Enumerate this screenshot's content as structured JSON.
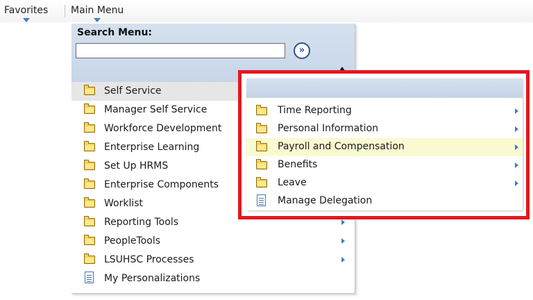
{
  "topbar": {
    "favorites_label": "Favorites",
    "main_menu_label": "Main Menu"
  },
  "search": {
    "label": "Search Menu:",
    "value": "",
    "placeholder": "",
    "go_symbol": "»"
  },
  "main_menu": {
    "items": [
      {
        "label": "Self Service",
        "icon": "folder-icon",
        "has_submenu": true,
        "active": true
      },
      {
        "label": "Manager Self Service",
        "icon": "folder-icon",
        "has_submenu": true
      },
      {
        "label": "Workforce Development",
        "icon": "folder-icon",
        "has_submenu": true
      },
      {
        "label": "Enterprise Learning",
        "icon": "folder-icon",
        "has_submenu": true
      },
      {
        "label": "Set Up HRMS",
        "icon": "folder-icon",
        "has_submenu": true
      },
      {
        "label": "Enterprise Components",
        "icon": "folder-icon",
        "has_submenu": true
      },
      {
        "label": "Worklist",
        "icon": "folder-icon",
        "has_submenu": true
      },
      {
        "label": "Reporting Tools",
        "icon": "folder-icon",
        "has_submenu": true
      },
      {
        "label": "PeopleTools",
        "icon": "folder-icon",
        "has_submenu": true
      },
      {
        "label": "LSUHSC Processes",
        "icon": "folder-icon",
        "has_submenu": true
      },
      {
        "label": "My Personalizations",
        "icon": "document-icon",
        "has_submenu": false
      }
    ]
  },
  "submenu": {
    "items": [
      {
        "label": "Time Reporting",
        "icon": "folder-icon",
        "has_submenu": true
      },
      {
        "label": "Personal Information",
        "icon": "folder-icon",
        "has_submenu": true
      },
      {
        "label": "Payroll and Compensation",
        "icon": "folder-icon",
        "has_submenu": true,
        "highlighted": true
      },
      {
        "label": "Benefits",
        "icon": "folder-icon",
        "has_submenu": true
      },
      {
        "label": "Leave",
        "icon": "folder-icon",
        "has_submenu": true
      },
      {
        "label": "Manage Delegation",
        "icon": "document-icon",
        "has_submenu": false
      }
    ]
  },
  "colors": {
    "panel_blue": "#c7d6e8",
    "highlight_red": "#e3171f",
    "hover_yellow": "#fafad2",
    "arrow_blue": "#3b7fc4"
  }
}
